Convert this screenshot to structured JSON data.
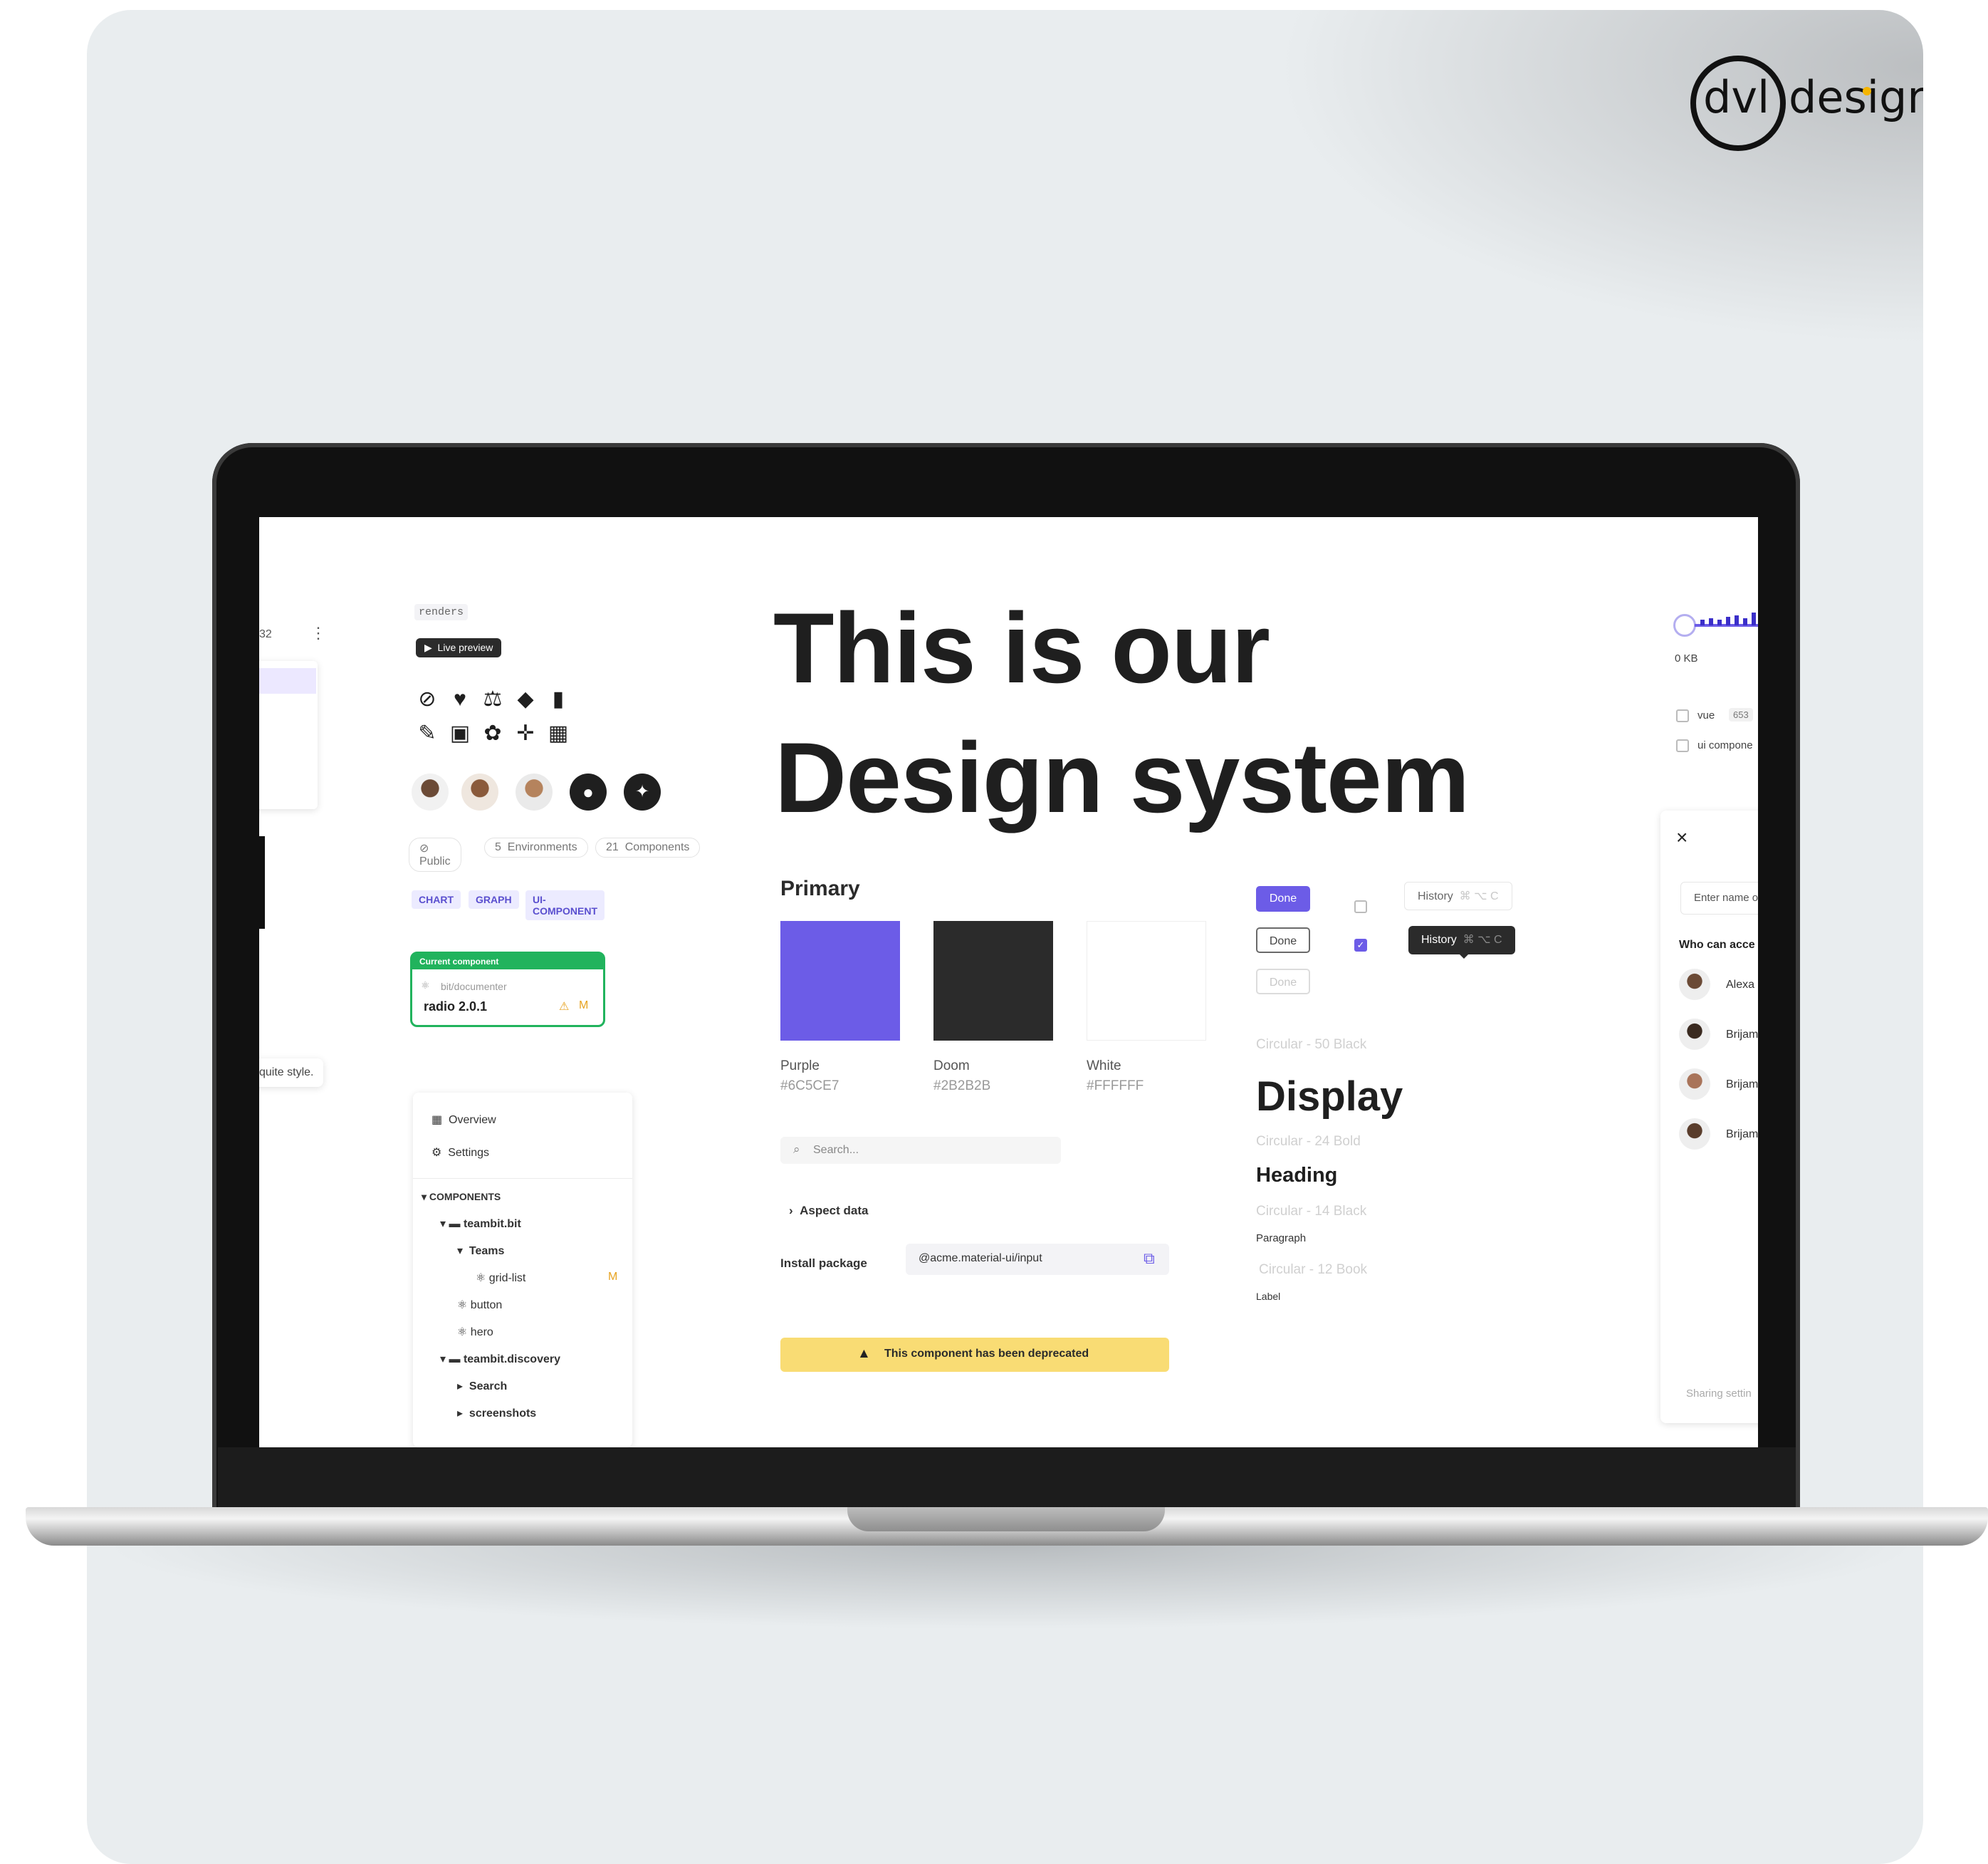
{
  "logo": {
    "dvl": "dvl",
    "design": "design"
  },
  "hero": {
    "line1": "This is our",
    "line2": "Design system"
  },
  "left_fragment": {
    "number": "32",
    "menu": "⋮",
    "arrows": "»",
    "quote": "quite style."
  },
  "renders_tag": "renders",
  "live_preview": "Live preview",
  "icons": [
    "globe-icon",
    "heart-icon",
    "scale-icon",
    "bell-icon",
    "file-icon",
    "wrench-icon",
    "lock-icon",
    "gear-icon",
    "drone-icon",
    "grid-icon"
  ],
  "icon_glyphs": [
    "⊘",
    "♥",
    "⚖",
    "◆",
    "▮",
    "✎",
    "▣",
    "✿",
    "✛",
    "▦"
  ],
  "meta_pills": {
    "public": "Public",
    "environments_count": "5",
    "environments": "Environments",
    "components_count": "21",
    "components": "Components"
  },
  "tags": [
    "CHART",
    "GRAPH",
    "UI-COMPONENT"
  ],
  "current_component": {
    "header": "Current component",
    "scope": "bit/documenter",
    "name": "radio 2.0.1",
    "status": "M"
  },
  "nav": {
    "overview": "Overview",
    "settings": "Settings",
    "components_header": "COMPONENTS",
    "tree": [
      {
        "label": "teambit.bit",
        "bold": true
      },
      {
        "label": "Teams",
        "bold": true
      },
      {
        "label": "grid-list",
        "bold": false,
        "badge": "M"
      },
      {
        "label": "button",
        "bold": false
      },
      {
        "label": "hero",
        "bold": false
      },
      {
        "label": "teambit.discovery",
        "bold": true
      },
      {
        "label": "Search",
        "bold": true
      },
      {
        "label": "screenshots",
        "bold": true
      }
    ]
  },
  "primary": {
    "title": "Primary",
    "swatches": [
      {
        "name": "Purple",
        "hex": "#6C5CE7",
        "color": "#6C5CE7"
      },
      {
        "name": "Doom",
        "hex": "#2B2B2B",
        "color": "#2B2B2B"
      },
      {
        "name": "White",
        "hex": "#FFFFFF",
        "color": "#FFFFFF"
      }
    ]
  },
  "search": {
    "placeholder": "Search..."
  },
  "aspect": "Aspect data",
  "install": {
    "label": "Install package",
    "value": "@acme.material-ui/input"
  },
  "deprecated": "This component has been deprecated",
  "buttons": {
    "primary": "Done",
    "outline": "Done",
    "disabled": "Done"
  },
  "history": {
    "label": "History",
    "shortcut": "⌘ ⌥ C"
  },
  "typography": {
    "display_meta": "Circular - 50 Black",
    "display": "Display",
    "heading_meta": "Circular - 24 Bold",
    "heading": "Heading",
    "paragraph_meta": "Circular - 14 Black",
    "paragraph": "Paragraph",
    "label_meta": "Circular - 12 Book",
    "label": "Label"
  },
  "right_fragment": {
    "size": "0 KB",
    "filters": [
      {
        "label": "vue",
        "count": "653"
      },
      {
        "label": "ui compone",
        "count": ""
      }
    ],
    "close": "×",
    "input_placeholder": "Enter name o",
    "who_can": "Who can acce",
    "people": [
      "Alexa",
      "Brijam",
      "Brijam",
      "Brijam"
    ],
    "sharing": "Sharing settin"
  },
  "colors": {
    "accent": "#6C5CE7",
    "dark": "#2B2B2B",
    "success": "#21b35d",
    "warning": "#f9dc74",
    "card_bg": "#e9edef"
  }
}
